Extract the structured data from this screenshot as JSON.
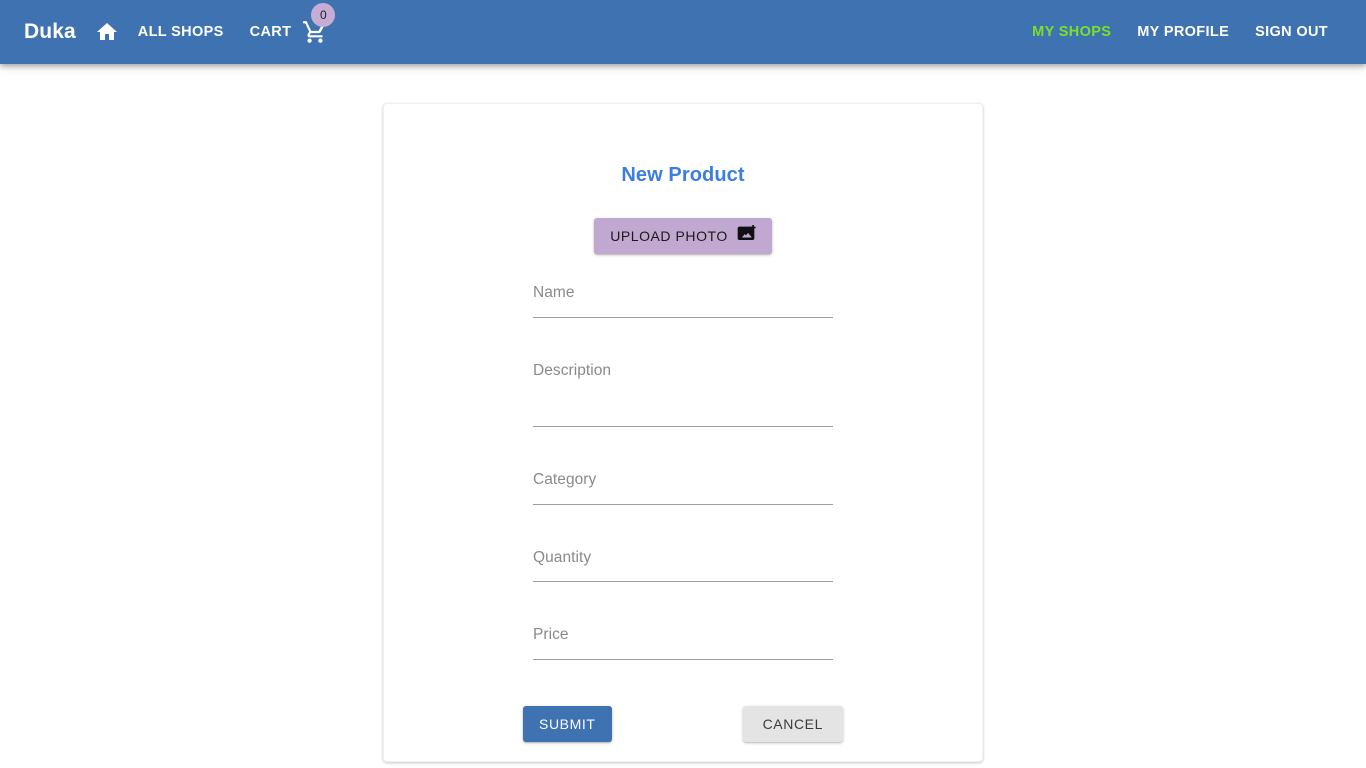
{
  "navbar": {
    "brand": "Duka",
    "home_icon": "home-icon",
    "left_links": [
      {
        "label": "ALL SHOPS",
        "name": "nav-link-all-shops"
      }
    ],
    "cart": {
      "label": "CART",
      "icon": "shopping-cart-icon",
      "badge_count": "0"
    },
    "right_links": [
      {
        "label": "MY SHOPS",
        "name": "nav-link-my-shops",
        "color": "#79E02E",
        "active": true
      },
      {
        "label": "MY PROFILE",
        "name": "nav-link-my-profile",
        "color": "#FFFFFF",
        "active": false
      },
      {
        "label": "SIGN OUT",
        "name": "nav-link-sign-out",
        "color": "#FFFFFF",
        "active": false
      }
    ],
    "background_color": "#3F72B0"
  },
  "card": {
    "title": "New Product",
    "title_color": "#3B7DE0",
    "upload_button": {
      "label": "UPLOAD PHOTO",
      "icon": "add-photo-icon",
      "background_color": "#C0A8D0"
    },
    "fields": [
      {
        "name": "name-input",
        "placeholder": "Name",
        "value": "",
        "multiline": false
      },
      {
        "name": "description-input",
        "placeholder": "Description",
        "value": "",
        "multiline": true
      },
      {
        "name": "category-input",
        "placeholder": "Category",
        "value": "",
        "multiline": false
      },
      {
        "name": "quantity-input",
        "placeholder": "Quantity",
        "value": "",
        "multiline": false
      },
      {
        "name": "price-input",
        "placeholder": "Price",
        "value": "",
        "multiline": false
      }
    ],
    "submit_label": "SUBMIT",
    "cancel_label": "CANCEL",
    "submit_color": "#3F72B0",
    "cancel_color": "#E4E4E4"
  }
}
